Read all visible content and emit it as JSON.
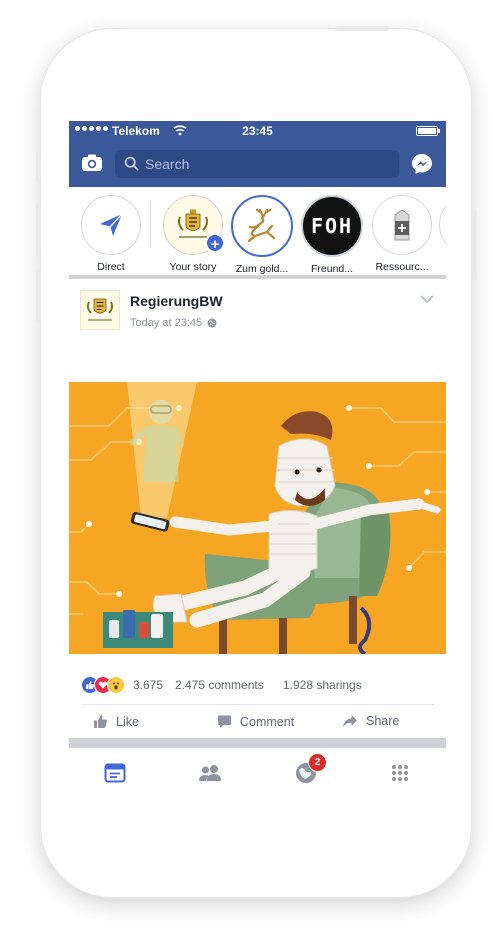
{
  "status_bar": {
    "carrier": "Telekom",
    "time": "23:45"
  },
  "nav": {
    "search_placeholder": "Search"
  },
  "stories": [
    {
      "label": "Direct"
    },
    {
      "label": "Your story"
    },
    {
      "label": "Zum gold..."
    },
    {
      "label": "Freund..."
    },
    {
      "label": "Ressourc..."
    }
  ],
  "story_logo_text": "FOH",
  "post": {
    "author": "RegierungBW",
    "timestamp": "Today at 23:45",
    "reactions": {
      "count": "3.675",
      "comments": "2.475 comments",
      "shares": "1.928 sharings"
    },
    "actions": {
      "like": "Like",
      "comment": "Comment",
      "share": "Share"
    }
  },
  "tabbar": {
    "notifications_badge": "2"
  },
  "colors": {
    "brand": "#3b5998",
    "accent": "#4267d6",
    "image_bg": "#f7a623",
    "badge": "#e02a2a"
  },
  "icons": [
    "camera-icon",
    "search-icon",
    "messenger-icon",
    "direct-send-icon",
    "plus-icon",
    "chevron-down-icon",
    "globe-icon",
    "like-icon",
    "comment-icon",
    "share-icon",
    "news-feed-icon",
    "friends-icon",
    "notifications-globe-icon",
    "menu-grid-icon"
  ]
}
